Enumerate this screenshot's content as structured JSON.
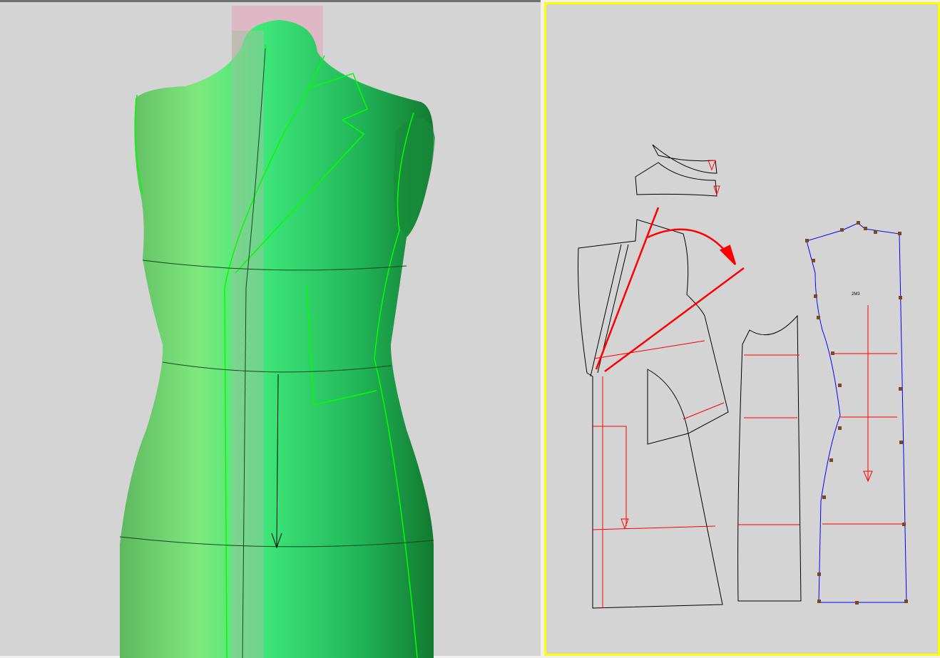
{
  "panes": {
    "left": "3d-view",
    "right": "pattern-view"
  },
  "pattern": {
    "piece_label": "2M3"
  },
  "colors": {
    "body": "#2fc860",
    "outline": "#00ff00",
    "pattern_line": "#000000",
    "guide": "#ff0000",
    "piece_outline_selected": "#0000ff",
    "point": "#7a4a1e",
    "active_border": "#ffff00"
  }
}
